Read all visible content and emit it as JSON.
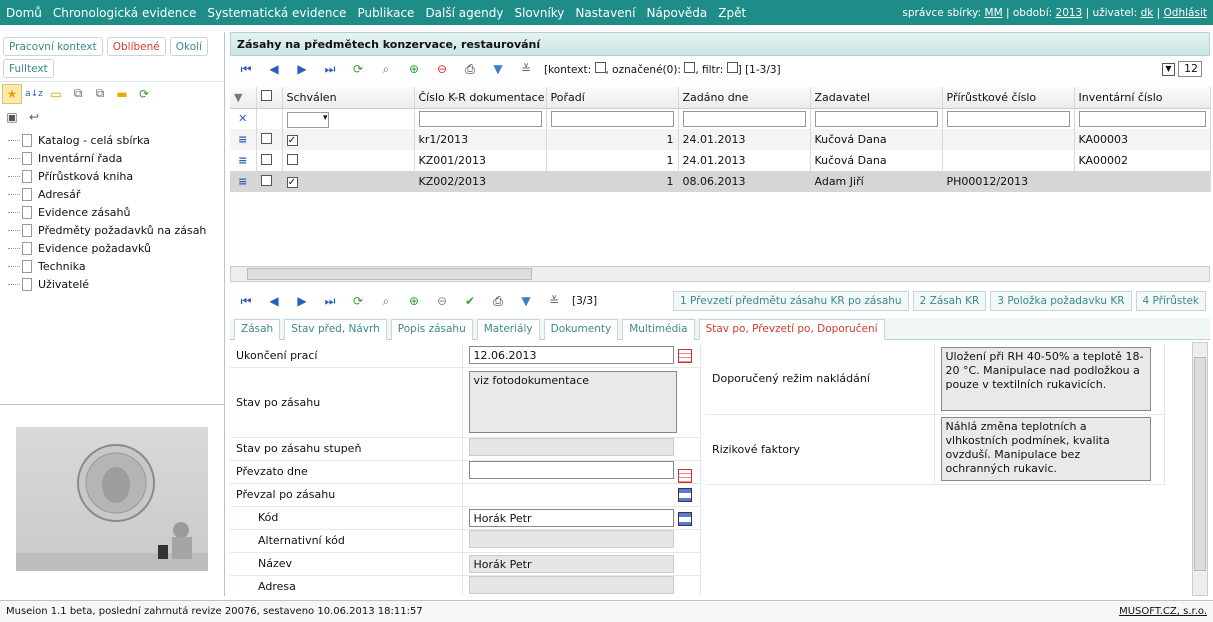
{
  "menu": {
    "items": [
      "Domů",
      "Chronologická evidence",
      "Systematická evidence",
      "Publikace",
      "Další agendy",
      "Slovníky",
      "Nastavení",
      "Nápověda",
      "Zpět"
    ],
    "admin_label": "správce sbírky:",
    "admin_value": "MM",
    "period_label": "| období:",
    "period_value": "2013",
    "user_label": "| uživatel:",
    "user_value": "dk",
    "logout": "Odhlásit"
  },
  "left": {
    "tabs": [
      "Pracovní kontext",
      "Oblíbené",
      "Okolí",
      "Fulltext"
    ],
    "tree": [
      "Katalog - celá sbírka",
      "Inventární řada",
      "Přírůstková kniha",
      "Adresář",
      "Evidence zásahů",
      "Předměty požadavků na zásah",
      "Evidence požadavků",
      "Technika",
      "Uživatelé"
    ]
  },
  "grid": {
    "title": "Zásahy na předmětech konzervace, restaurování",
    "info": "[kontext:",
    "info2": ", označené(0):",
    "info3": ", filtr:",
    "info4": "] [1-3/3]",
    "page_size": "12",
    "columns": [
      "Schválen",
      "Číslo K-R dokumentace",
      "Pořadí",
      "Zadáno dne",
      "Zadavatel",
      "Přírůstkové číslo",
      "Inventární číslo"
    ],
    "rows": [
      {
        "schvalen": "✓",
        "cislo": "kr1/2013",
        "poradi": "1",
        "zadano": "24.01.2013",
        "zadavatel": "Kučová Dana",
        "prirustkove": "",
        "inventarni": "KA00003"
      },
      {
        "schvalen": "",
        "cislo": "KZ001/2013",
        "poradi": "1",
        "zadano": "24.01.2013",
        "zadavatel": "Kučová Dana",
        "prirustkove": "",
        "inventarni": "KA00002"
      },
      {
        "schvalen": "✓",
        "cislo": "KZ002/2013",
        "poradi": "1",
        "zadano": "08.06.2013",
        "zadavatel": "Adam Jiří",
        "prirustkove": "PH00012/2013",
        "inventarni": ""
      }
    ]
  },
  "detail": {
    "counter": "[3/3]",
    "links": [
      "1 Převzetí předmětu zásahu KR po zásahu",
      "2 Zásah KR",
      "3 Položka požadavku KR",
      "4 Přírůstek"
    ],
    "tabs": [
      "Zásah",
      "Stav před, Návrh",
      "Popis zásahu",
      "Materiály",
      "Dokumenty",
      "Multimédia",
      "Stav po, Převzetí po, Doporučení"
    ],
    "fields": {
      "ukonceni_label": "Ukončení prací",
      "ukonceni_value": "12.06.2013",
      "stav_po_label": "Stav po zásahu",
      "stav_po_value": "viz fotodokumentace",
      "stav_stupen_label": "Stav po zásahu stupeň",
      "prevzato_label": "Převzato dne",
      "prevzal_label": "Převzal po zásahu",
      "kod_label": "Kód",
      "kod_value": "Horák Petr",
      "alt_kod_label": "Alternativní kód",
      "nazev_label": "Název",
      "nazev_value": "Horák Petr",
      "adresa_label": "Adresa",
      "rezim_label": "Doporučený režim nakládání",
      "rezim_value": "Uložení při RH 40-50% a teplotě 18-20 °C. Manipulace nad podložkou a pouze v textilních rukavicích.",
      "riziko_label": "Rizikové faktory",
      "riziko_value": "Náhlá změna teplotních a vlhkostních podmínek, kvalita ovzduší. Manipulace bez ochranných rukavic."
    }
  },
  "status": {
    "text": "Museion 1.1 beta, poslední zahrnutá revize 20076, sestaveno 10.06.2013 18:11:57",
    "company": "MUSOFT.CZ, s.r.o."
  }
}
